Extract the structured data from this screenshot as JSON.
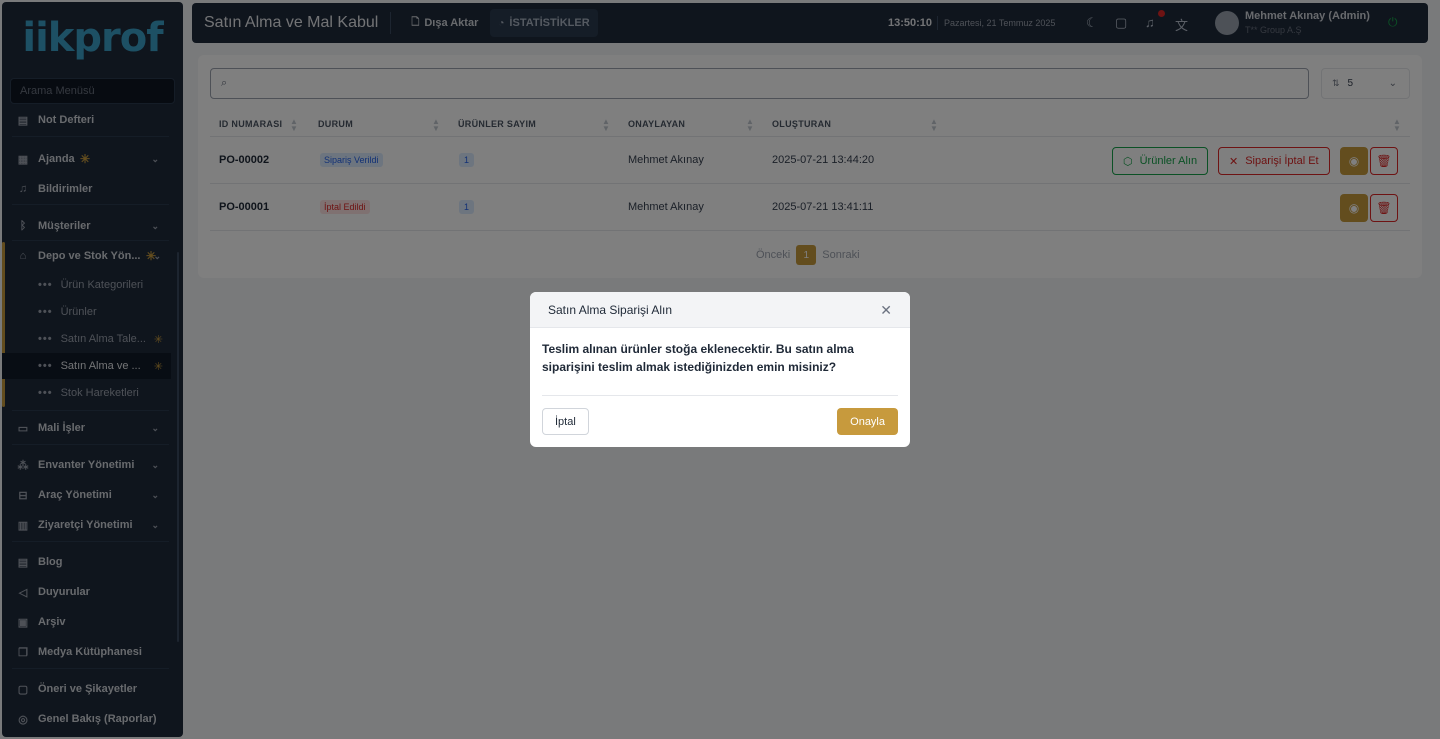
{
  "sidebar": {
    "logo": "iikprof",
    "search_placeholder": "Arama Menüsü",
    "items": {
      "notes": "Not Defteri",
      "agenda": "Ajanda",
      "notifications": "Bildirimler",
      "customers": "Müşteriler",
      "warehouse": "Depo ve Stok Yön...",
      "product_categories": "Ürün Kategorileri",
      "products": "Ürünler",
      "purchase_requests": "Satın Alma Tale...",
      "purchase_receipt": "Satın Alma ve ...",
      "stock_movements": "Stok Hareketleri",
      "finance": "Mali İşler",
      "inventory": "Envanter Yönetimi",
      "vehicles": "Araç Yönetimi",
      "visitors": "Ziyaretçi Yönetimi",
      "blog": "Blog",
      "announcements": "Duyurular",
      "archive": "Arşiv",
      "media": "Medya Kütüphanesi",
      "feedback": "Öneri ve Şikayetler",
      "overview": "Genel Bakış (Raporlar)"
    }
  },
  "header": {
    "title": "Satın Alma ve Mal Kabul",
    "export_label": "Dışa Aktar",
    "stats_label": "İSTATİSTİKLER",
    "time": "13:50:10",
    "date": "Pazartesi, 21 Temmuz 2025",
    "user_name": "Mehmet Akınay (Admin)",
    "user_company": "T** Group A.Ş"
  },
  "table": {
    "search_placeholder": "",
    "page_size": "5",
    "columns": [
      "ID NUMARASI",
      "DURUM",
      "ÜRÜNLER SAYIM",
      "ONAYLAYAN",
      "OLUŞTURAN"
    ],
    "rows": [
      {
        "id": "PO-00002",
        "status": "Sipariş Verildi",
        "count": "1",
        "approver": "Mehmet Akınay",
        "created": "2025-07-21 13:44:20",
        "receive_label": "Ürünler Alın",
        "cancel_label": "Siparişi İptal Et"
      },
      {
        "id": "PO-00001",
        "status": "İptal Edildi",
        "count": "1",
        "approver": "Mehmet Akınay",
        "created": "2025-07-21 13:41:11"
      }
    ],
    "pager": {
      "prev": "Önceki",
      "page": "1",
      "next": "Sonraki"
    }
  },
  "modal": {
    "title": "Satın Alma Siparişi Alın",
    "body": "Teslim alınan ürünler stoğa eklenecektir. Bu satın alma siparişini teslim almak istediğinizden emin misiniz?",
    "cancel_label": "İptal",
    "confirm_label": "Onayla"
  },
  "colors": {
    "accent": "#c79a3d",
    "sidebar": "#1e2a3b",
    "success": "#16a34a",
    "danger": "#dc2626"
  }
}
